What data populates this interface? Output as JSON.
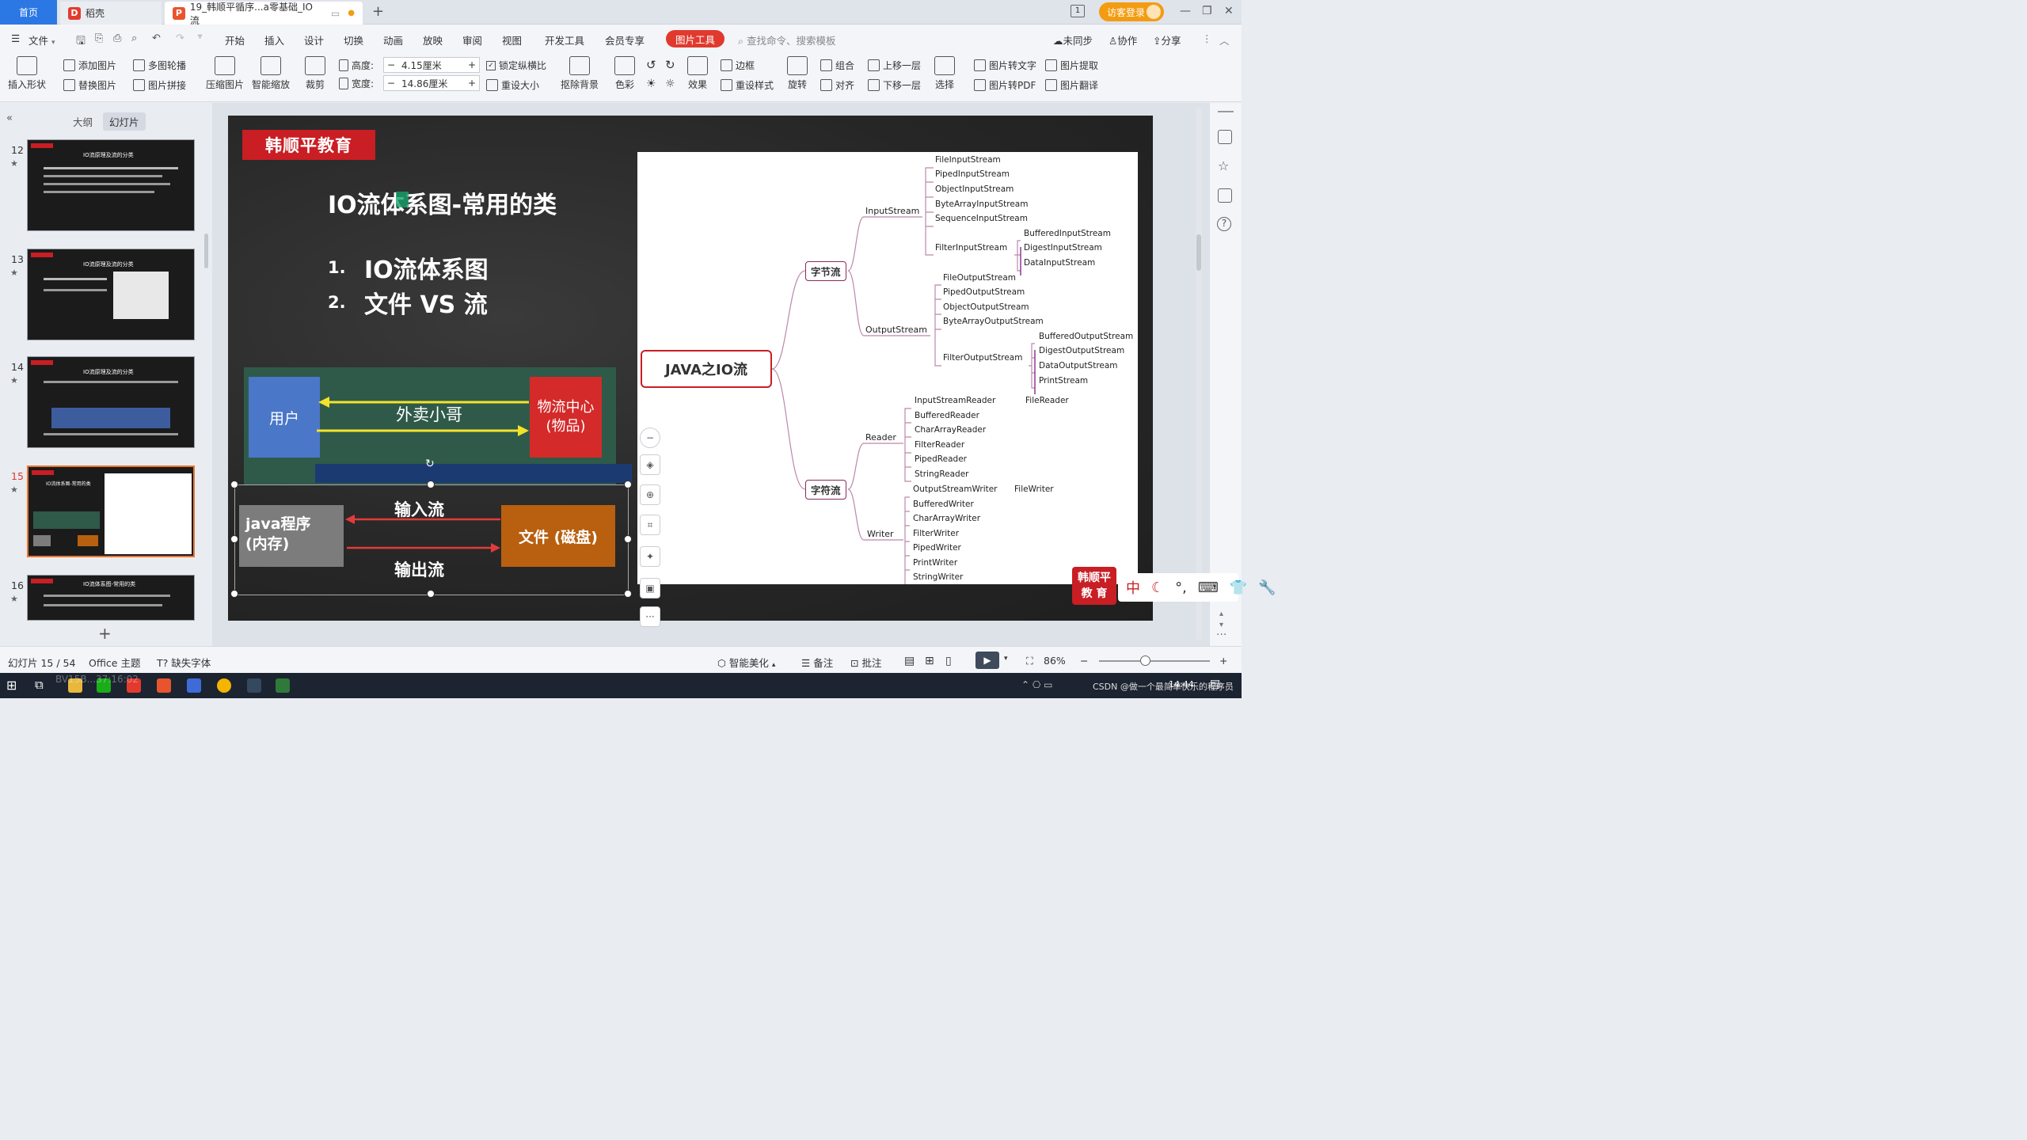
{
  "tabs": {
    "home": "首页",
    "daoke": "稻壳",
    "doc": "19_韩顺平循序...a零基础_IO流",
    "add": "+"
  },
  "titlebar": {
    "login": "访客登录",
    "page_badge": "1"
  },
  "menu": {
    "file": "文件",
    "items": [
      "开始",
      "插入",
      "设计",
      "切换",
      "动画",
      "放映",
      "审阅",
      "视图",
      "开发工具",
      "会员专享"
    ],
    "pic_tool": "图片工具",
    "search_placeholder": "查找命令、搜索模板",
    "unsynced": "未同步",
    "collab": "协作",
    "share": "分享"
  },
  "ribbon": {
    "insert_shape": "插入形状",
    "add_image": "添加图片",
    "replace_image": "替换图片",
    "multi_carousel": "多图轮播",
    "image_stitch": "图片拼接",
    "compress": "压缩图片",
    "smart_scale": "智能缩放",
    "crop": "裁剪",
    "height_label": "高度:",
    "height_value": "4.15厘米",
    "width_label": "宽度:",
    "width_value": "14.86厘米",
    "lock_ratio": "锁定纵横比",
    "reset_size": "重设大小",
    "remove_bg": "抠除背景",
    "color": "色彩",
    "effect": "效果",
    "border": "边框",
    "reset_style": "重设样式",
    "rotate": "旋转",
    "group": "组合",
    "align": "对齐",
    "bring_forward": "上移一层",
    "send_backward": "下移一层",
    "select": "选择",
    "pic_to_text": "图片转文字",
    "pic_extract": "图片提取",
    "pic_to_pdf": "图片转PDF",
    "pic_translate": "图片翻译"
  },
  "leftpanel": {
    "outline_tab": "大纲",
    "slides_tab": "幻灯片",
    "slides": [
      {
        "num": "12",
        "title": "IO流原理及流的分类"
      },
      {
        "num": "13",
        "title": "IO流原理及流的分类"
      },
      {
        "num": "14",
        "title": "IO流原理及流的分类"
      },
      {
        "num": "15",
        "title": "IO流体系图-常用的类"
      },
      {
        "num": "16",
        "title": "IO流体系图-常用的类"
      }
    ],
    "add": "+"
  },
  "slide": {
    "brand": "韩顺平教育",
    "title": "IO流体系图-常用的类",
    "list": [
      {
        "num": "1.",
        "text": "IO流体系图"
      },
      {
        "num": "2.",
        "text": "文件 VS 流"
      }
    ],
    "user_box": "用户",
    "courier": "外卖小哥",
    "logistics_line1": "物流中心",
    "logistics_line2": "(物品)",
    "java_line1": "java程序",
    "java_line2": "(内存)",
    "file_box": "文件 (磁盘)",
    "input_stream": "输入流",
    "output_stream": "输出流"
  },
  "mindmap": {
    "root": "JAVA之IO流",
    "byte_stream": "字节流",
    "char_stream": "字符流",
    "input_stream": "InputStream",
    "output_stream": "OutputStream",
    "reader": "Reader",
    "writer": "Writer",
    "input_children": [
      "FileInputStream",
      "PipedInputStream",
      "ObjectInputStream",
      "ByteArrayInputStream",
      "SequenceInputStream",
      "FilterInputStream"
    ],
    "filter_input_children": [
      "BufferedInputStream",
      "DigestInputStream",
      "DataInputStream"
    ],
    "output_children": [
      "FileOutputStream",
      "PipedOutputStream",
      "ObjectOutputStream",
      "ByteArrayOutputStream",
      "FilterOutputStream"
    ],
    "filter_output_children": [
      "BufferedOutputStream",
      "DigestOutputStream",
      "DataOutputStream",
      "PrintStream"
    ],
    "reader_children": [
      "InputStreamReader",
      "BufferedReader",
      "CharArrayReader",
      "FilterReader",
      "PipedReader",
      "StringReader"
    ],
    "isr_child": "FileReader",
    "writer_children": [
      "OutputStreamWriter",
      "BufferedWriter",
      "CharArrayWriter",
      "FilterWriter",
      "PipedWriter",
      "PrintWriter",
      "StringWriter"
    ],
    "osw_child": "FileWriter"
  },
  "floattools": {
    "more": "···"
  },
  "stamp": {
    "line1": "韩顺平",
    "line2": "教 育"
  },
  "ime": {
    "zh": "中"
  },
  "status": {
    "slide_index": "幻灯片 15 / 54",
    "theme": "Office 主题",
    "missing_font": "缺失字体",
    "smart_beautify": "智能美化",
    "notes": "备注",
    "comment": "批注",
    "zoom": "86%"
  },
  "taskbar": {
    "watermark_left": "BV15B...37:16:02",
    "watermark_right": "CSDN @做一个最简单快乐的程序员",
    "time": "14:44"
  },
  "colors": {
    "accent_blue": "#2b78e4",
    "accent_red": "#c81e24",
    "login_orange": "#f39c12"
  }
}
